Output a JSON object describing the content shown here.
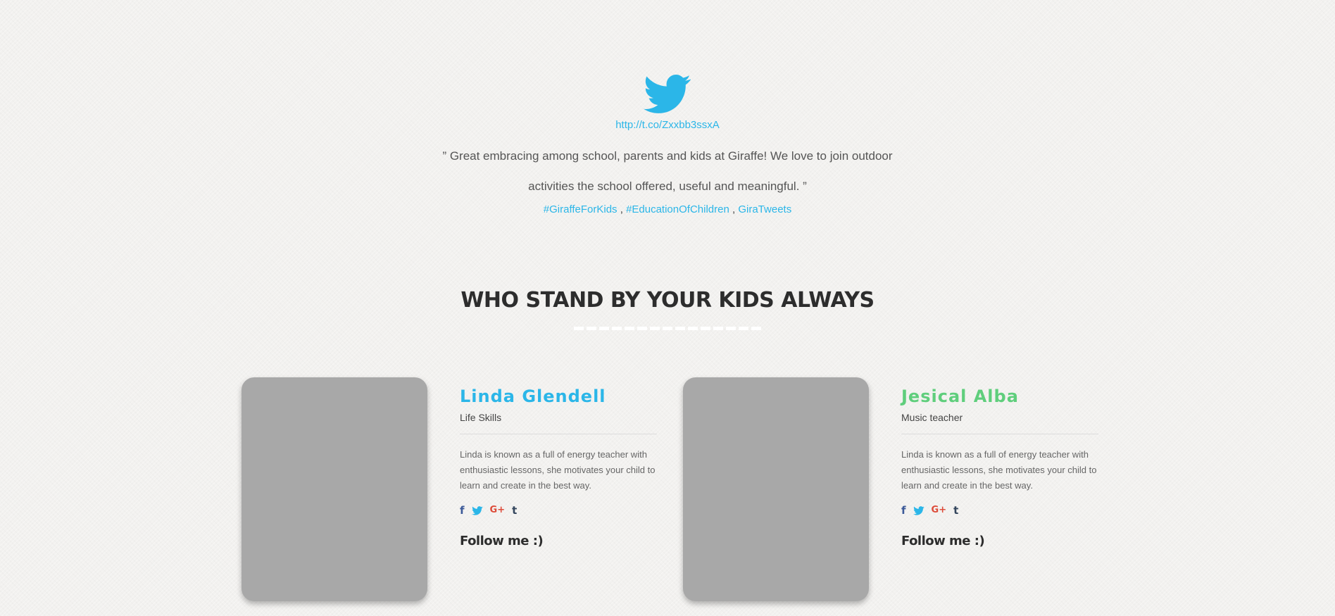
{
  "tweet": {
    "icon": "twitter-bird-icon",
    "link": "http://t.co/Zxxbb3ssxA",
    "quote_line1": "” Great embracing among school, parents and kids at Giraffe! We love to join outdoor",
    "quote_line2": "activities the school offered, useful and meaningful. ”",
    "tags": [
      "#GiraffeForKids",
      "#EducationOfChildren",
      "GiraTweets"
    ],
    "separator": " , "
  },
  "section": {
    "title": "WHO STAND BY YOUR KIDS ALWAYS"
  },
  "teachers": [
    {
      "name": "Linda Glendell",
      "role": "Life Skills",
      "bio": "Linda is known as a full of energy teacher with enthusiastic lessons, she motivates your child to learn and create in the best way.",
      "follow": "Follow me :)",
      "name_color": "#2bb6e8"
    },
    {
      "name": "Jesical Alba",
      "role": "Music teacher",
      "bio": "Linda is known as a full of energy teacher with enthusiastic lessons, she motivates your child to learn and create in the best way.",
      "follow": "Follow me :)",
      "name_color": "#5fce7c"
    }
  ],
  "social_icons": {
    "facebook": "f",
    "twitter": "twitter-icon",
    "googleplus": "G+",
    "tumblr": "t"
  },
  "colors": {
    "accent_blue": "#2bb6e8",
    "accent_green": "#5fce7c",
    "heading": "#2d2d2d",
    "background": "#f2f1ef"
  }
}
